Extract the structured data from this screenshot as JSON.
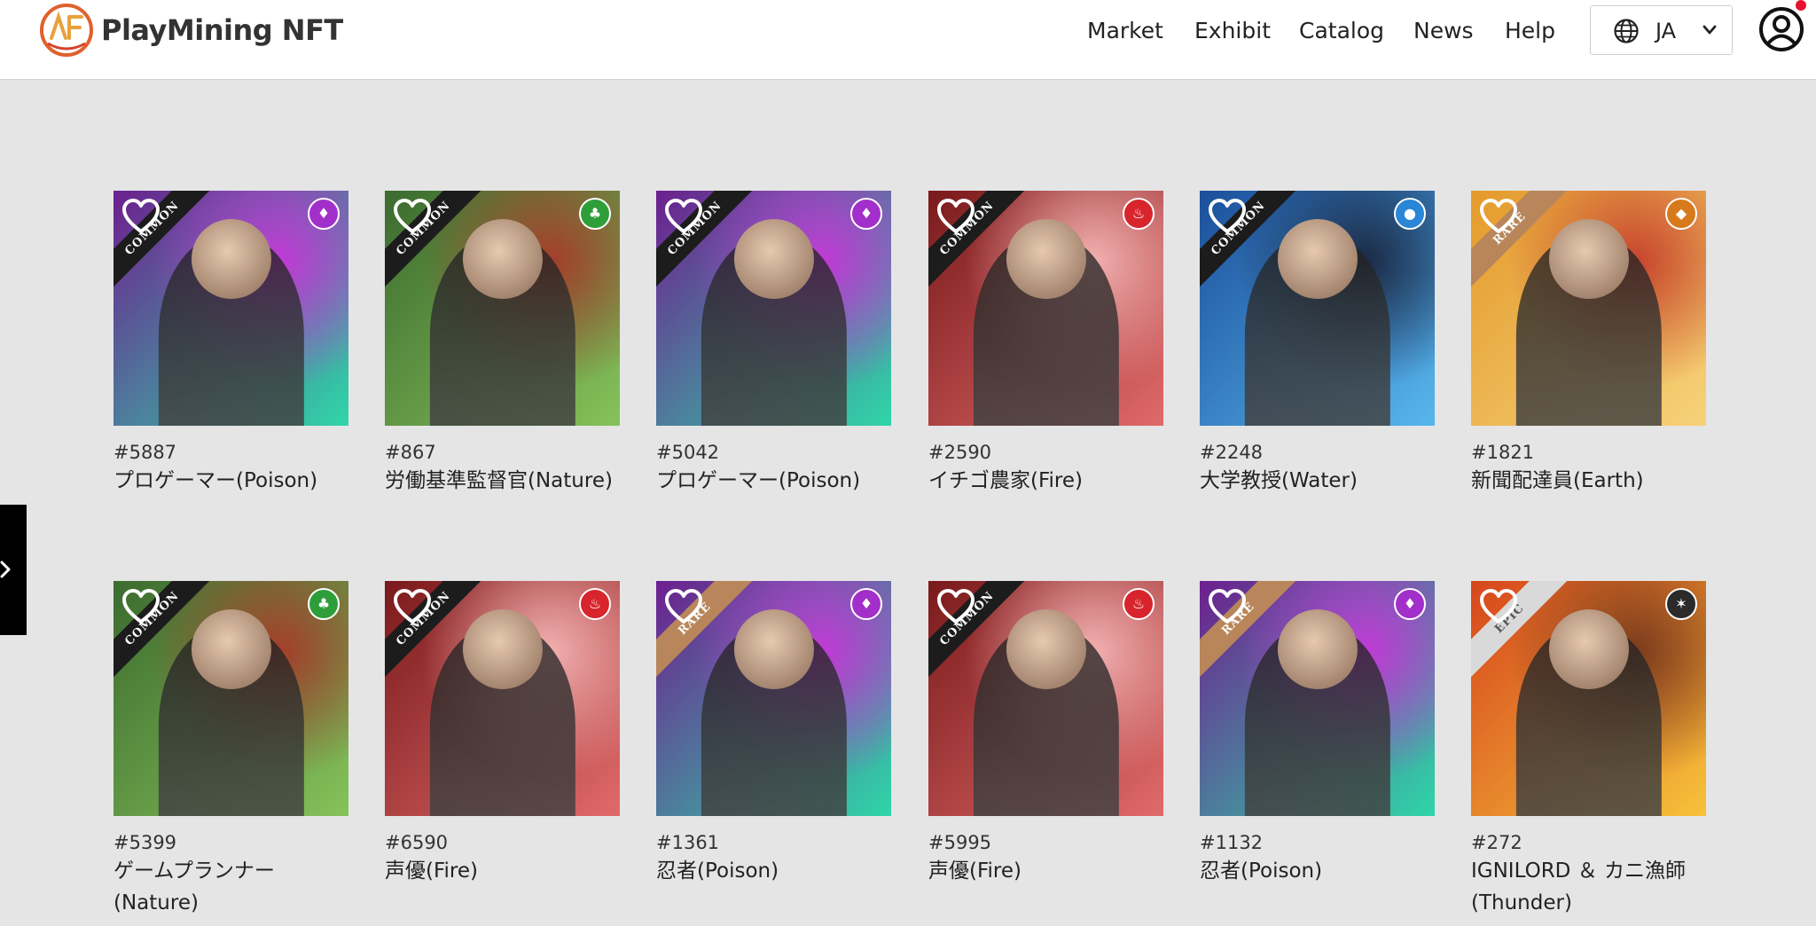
{
  "brand": {
    "name": "PlayMining NFT"
  },
  "nav": {
    "items": [
      "Market",
      "Exhibit",
      "Catalog",
      "News",
      "Help"
    ]
  },
  "language": {
    "current": "JA"
  },
  "cards": [
    {
      "number": "#5887",
      "name": "プロゲーマー(Poison)",
      "rarity": "COMMON",
      "element": "poison"
    },
    {
      "number": "#867",
      "name": "労働基準監督官(Nature)",
      "rarity": "COMMON",
      "element": "nature"
    },
    {
      "number": "#5042",
      "name": "プロゲーマー(Poison)",
      "rarity": "COMMON",
      "element": "poison"
    },
    {
      "number": "#2590",
      "name": "イチゴ農家(Fire)",
      "rarity": "COMMON",
      "element": "fire"
    },
    {
      "number": "#2248",
      "name": "大学教授(Water)",
      "rarity": "COMMON",
      "element": "water"
    },
    {
      "number": "#1821",
      "name": "新聞配達員(Earth)",
      "rarity": "RARE",
      "element": "earth"
    },
    {
      "number": "#5399",
      "name": "ゲームプランナー(Nature)",
      "rarity": "COMMON",
      "element": "nature"
    },
    {
      "number": "#6590",
      "name": "声優(Fire)",
      "rarity": "COMMON",
      "element": "fire"
    },
    {
      "number": "#1361",
      "name": "忍者(Poison)",
      "rarity": "RARE",
      "element": "poison"
    },
    {
      "number": "#5995",
      "name": "声優(Fire)",
      "rarity": "COMMON",
      "element": "fire"
    },
    {
      "number": "#1132",
      "name": "忍者(Poison)",
      "rarity": "RARE",
      "element": "poison"
    },
    {
      "number": "#272",
      "name": "IGNILORD ＆ カニ漁師(Thunder)",
      "rarity": "EPIC",
      "element": "thunder"
    }
  ],
  "colors": {
    "poison": "#a22fc9",
    "nature": "#2f9e3a",
    "fire": "#d8242c",
    "water": "#2a86d6",
    "earth": "#d77a1c",
    "thunder": "#2b2b2b",
    "accent": "#e8112d"
  },
  "icons": {
    "favorite": "heart-outline-icon",
    "language": "globe-icon",
    "account": "user-circle-icon",
    "drawer": "chevron-right-icon"
  }
}
